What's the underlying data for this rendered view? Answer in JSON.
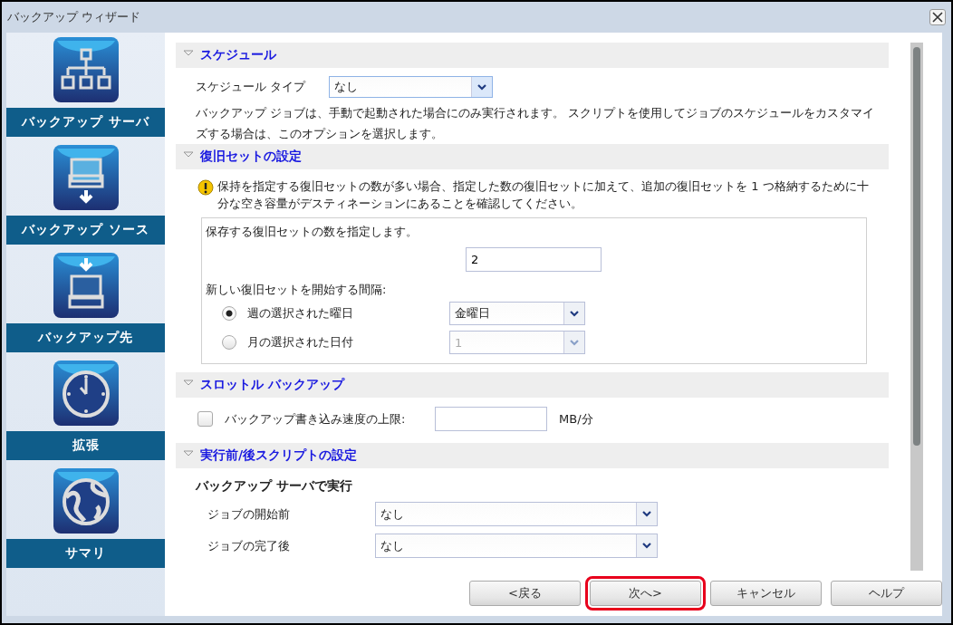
{
  "window": {
    "title": "バックアップ ウィザード"
  },
  "sidebar": {
    "items": [
      {
        "label": "バックアップ サーバ",
        "kind": "server"
      },
      {
        "label": "バックアップ ソース",
        "kind": "source"
      },
      {
        "label": "バックアップ先",
        "kind": "destination"
      },
      {
        "label": "拡張",
        "kind": "clock"
      },
      {
        "label": "サマリ",
        "kind": "globe"
      }
    ]
  },
  "schedule": {
    "title": "スケジュール",
    "expanded": true,
    "type_label": "スケジュール タイプ",
    "type_value": "なし",
    "description": "バックアップ ジョブは、手動で起動された場合にのみ実行されます。 スクリプトを使用してジョブのスケジュールをカスタマイズする場合は、このオプションを選択します。"
  },
  "recovery_sets": {
    "title": "復旧セットの設定",
    "expanded": true,
    "warning": "保持を指定する復旧セットの数が多い場合、指定した数の復旧セットに加えて、追加の復旧セットを 1 つ格納するために十分な空き容量がデスティネーションにあることを確認してください。",
    "count_label": "保存する復旧セットの数を指定します。",
    "count_value": "2",
    "interval_label": "新しい復旧セットを開始する間隔:",
    "options": [
      {
        "label": "週の選択された曜日",
        "selected": true,
        "value": "金曜日",
        "disabled": false
      },
      {
        "label": "月の選択された日付",
        "selected": false,
        "value": "1",
        "disabled": true
      }
    ]
  },
  "throttle": {
    "title": "スロットル バックアップ",
    "expanded": true,
    "label": "バックアップ書き込み速度の上限:",
    "checked": false,
    "unit": "MB/分"
  },
  "scripts": {
    "title": "実行前/後スクリプトの設定",
    "expanded": true,
    "subheading": "バックアップ サーバで実行",
    "rows": [
      {
        "label": "ジョブの開始前",
        "value": "なし"
      },
      {
        "label": "ジョブの完了後",
        "value": "なし"
      }
    ]
  },
  "buttons": [
    {
      "label": "<戻る",
      "highlighted": false
    },
    {
      "label": "次へ>",
      "highlighted": true
    },
    {
      "label": "キャンセル",
      "highlighted": false
    },
    {
      "label": "ヘルプ",
      "highlighted": false
    }
  ]
}
